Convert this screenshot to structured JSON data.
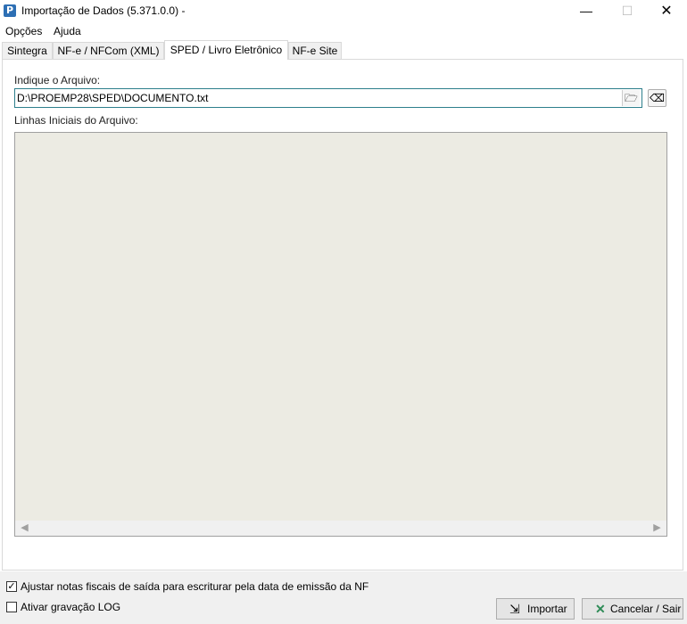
{
  "window": {
    "title": "Importação de Dados (5.371.0.0) -",
    "icon_letter": "P",
    "min_glyph": "—",
    "max_glyph": "☐",
    "close_glyph": "✕"
  },
  "menu": {
    "items": [
      "Opções",
      "Ajuda"
    ]
  },
  "tabs": [
    {
      "label": "Sintegra"
    },
    {
      "label": "NF-e / NFCom (XML)"
    },
    {
      "label": "SPED / Livro Eletrônico",
      "active": true
    },
    {
      "label": "NF-e Site"
    }
  ],
  "form": {
    "file_label": "Indique o Arquivo:",
    "file_value": "D:\\PROEMP28\\SPED\\DOCUMENTO.txt",
    "preview_label": "Linhas Iniciais do Arquivo:"
  },
  "options": {
    "adjust_label": "Ajustar notas fiscais de saída para escriturar pela data de emissão da NF",
    "adjust_checked": true,
    "log_label": "Ativar gravação LOG",
    "log_checked": false
  },
  "buttons": {
    "import_label": "Importar",
    "cancel_label": "Cancelar / Sair"
  },
  "colors": {
    "input_border": "#2d7f8c",
    "preview_bg": "#ecebe3",
    "cancel_icon": "#2e8b57"
  },
  "icons": {
    "browse": "folder-open-icon",
    "clear": "eraser-icon",
    "import": "import-icon",
    "cancel": "x-icon"
  }
}
